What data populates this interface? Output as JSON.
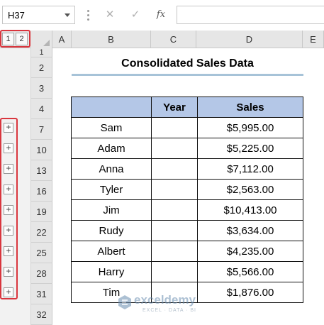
{
  "formula_bar": {
    "name_box": "H37",
    "cancel_icon": "✕",
    "enter_icon": "✓",
    "function_icon": "fx",
    "formula_value": ""
  },
  "outline": {
    "levels": [
      "1",
      "2"
    ],
    "expand_symbol": "+"
  },
  "columns": [
    "A",
    "B",
    "C",
    "D",
    "E"
  ],
  "rows": [
    "1",
    "2",
    "3",
    "4",
    "7",
    "10",
    "13",
    "16",
    "19",
    "22",
    "25",
    "28",
    "31",
    "32"
  ],
  "sheet": {
    "title": "Consolidated Sales Data",
    "table": {
      "headers": [
        "",
        "Year",
        "Sales"
      ],
      "rows": [
        [
          "Sam",
          "",
          "$5,995.00"
        ],
        [
          "Adam",
          "",
          "$5,225.00"
        ],
        [
          "Anna",
          "",
          "$7,112.00"
        ],
        [
          "Tyler",
          "",
          "$2,563.00"
        ],
        [
          "Jim",
          "",
          "$10,413.00"
        ],
        [
          "Rudy",
          "",
          "$3,634.00"
        ],
        [
          "Albert",
          "",
          "$4,235.00"
        ],
        [
          "Harry",
          "",
          "$5,566.00"
        ],
        [
          "Tim",
          "",
          "$1,876.00"
        ]
      ]
    }
  },
  "watermark": {
    "name": "exceldemy",
    "tagline": "EXCEL · DATA · BI"
  },
  "colors": {
    "header_fill": "#b4c7e7",
    "title_underline": "#a7c3d8",
    "highlight_border": "#d9363e"
  }
}
